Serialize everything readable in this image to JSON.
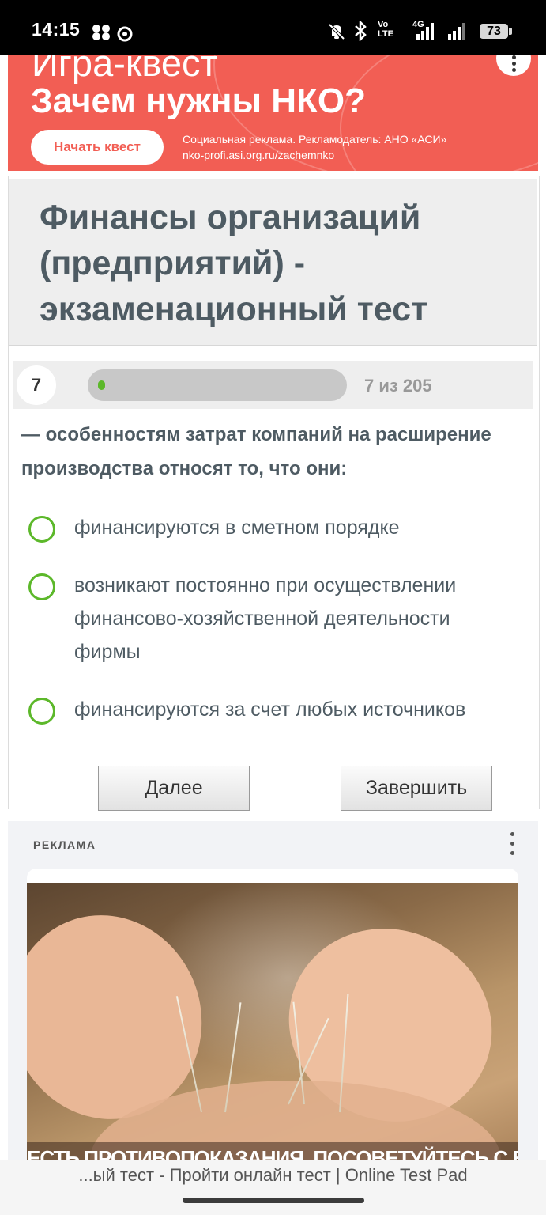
{
  "status_bar": {
    "time": "14:15",
    "volte": "Vo\nLTE",
    "network": "4G",
    "battery": "73",
    "icons": [
      "fan-icon",
      "vpn-icon",
      "mute-icon",
      "bluetooth-icon",
      "signal-icon"
    ]
  },
  "top_ad": {
    "title_line1": "Игра-квест",
    "title_line2": "Зачем нужны НКО?",
    "button": "Начать квест",
    "disclaimer": "Социальная реклама. Рекламодатель: АНО «АСИ»",
    "url": "nko-profi.asi.org.ru/zachemnko",
    "accent": "#f25e54"
  },
  "page": {
    "title": "Финансы организаций (предприятий) - экзаменационный тест"
  },
  "progress": {
    "question_number": "7",
    "count_label": "7 из 205",
    "fraction": 0.034,
    "fill_color": "#5cb82a"
  },
  "question": {
    "text": "— особенностям затрат компаний на расширение производства относят то, что они:",
    "options": [
      {
        "label": "финансируются в сметном порядке"
      },
      {
        "label": "возникают постоянно при осуществлении финансово-хозяйственной деятельности фирмы"
      },
      {
        "label": "финансируются за счет любых источников"
      }
    ]
  },
  "buttons": {
    "next": "Далее",
    "finish": "Завершить"
  },
  "bottom_ad": {
    "label": "РЕКЛАМА",
    "caption": "ЕСТЬ ПРОТИВОПОКАЗАНИЯ. ПОСОВЕТУЙТЕСЬ С ВРАЧОМ"
  },
  "browser": {
    "tab_title": "...ый тест - Пройти онлайн тест | Online Test Pad"
  }
}
